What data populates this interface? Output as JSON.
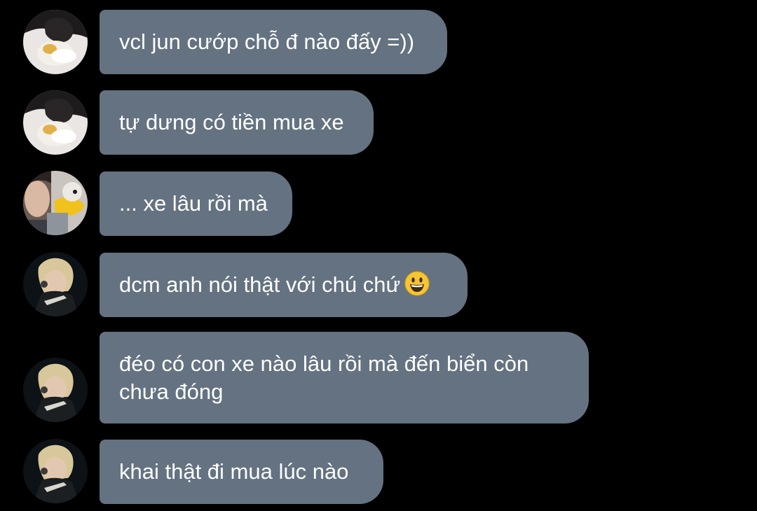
{
  "chat": {
    "messages": [
      {
        "sender": "A",
        "text": "vcl jun cướp chỗ đ nào đấy =))"
      },
      {
        "sender": "A",
        "text": "tự dưng có tiền mua xe"
      },
      {
        "sender": "B",
        "text": "... xe lâu rồi mà"
      },
      {
        "sender": "C",
        "text": "dcm anh nói thật với chú chứ",
        "emoji": "grinning-face-emoji"
      },
      {
        "sender": "C",
        "text": "đéo có con xe nào lâu rồi mà đến biển còn\nchưa đóng"
      },
      {
        "sender": "C",
        "text": "khai thật đi mua lúc nào"
      }
    ]
  },
  "colors": {
    "background": "#000000",
    "bubble": "#647281",
    "text": "#ffffff"
  }
}
